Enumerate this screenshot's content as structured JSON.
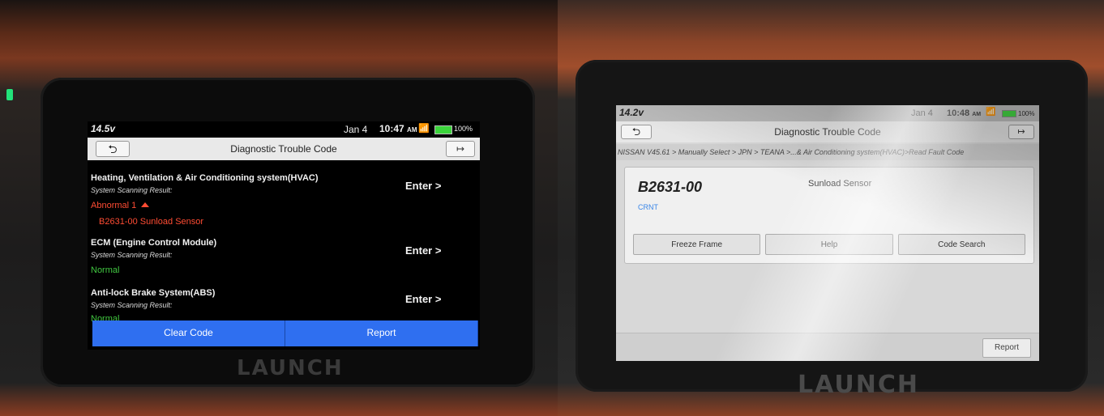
{
  "left": {
    "status_bar": {
      "voltage": "14.5v",
      "date": "Jan 4",
      "time": "10:47",
      "ampm": "AM",
      "battery": "100%"
    },
    "title_bar": {
      "back": "⮌",
      "title": "Diagnostic Trouble Code",
      "exit": "↦"
    },
    "systems": [
      {
        "name": "Heating, Ventilation & Air Conditioning system(HVAC)",
        "sub": "System Scanning Result:",
        "result": "Abnormal 1",
        "enter": "Enter >",
        "fault": "B2631-00 Sunload Sensor"
      },
      {
        "name": "ECM (Engine Control Module)",
        "sub": "System Scanning Result:",
        "result": "Normal",
        "enter": "Enter >"
      },
      {
        "name": "Anti-lock Brake System(ABS)",
        "sub": "System Scanning Result:",
        "result": "Normal",
        "enter": "Enter >"
      }
    ],
    "buttons": {
      "clear": "Clear Code",
      "report": "Report"
    },
    "brand": "LAUNCH"
  },
  "right": {
    "status_bar": {
      "voltage": "14.2v",
      "date": "Jan 4",
      "time": "10:48",
      "ampm": "AM",
      "battery": "100%"
    },
    "title_bar": {
      "back": "⮌",
      "title": "Diagnostic Trouble Code",
      "exit": "↦"
    },
    "breadcrumb": "NISSAN V45.61 > Manually Select > JPN > TEANA >...& Air Conditioning system(HVAC)>Read Fault Code",
    "dtc": {
      "code": "B2631-00",
      "description": "Sunload Sensor",
      "status": "CRNT"
    },
    "actions": {
      "freeze": "Freeze Frame",
      "help": "Help",
      "search": "Code Search"
    },
    "report": "Report",
    "brand": "LAUNCH"
  },
  "colors": {
    "accent": "#2f6ff0",
    "abnormal": "#ff4c33",
    "normal": "#40c640",
    "status_blue": "#3a86e8"
  }
}
